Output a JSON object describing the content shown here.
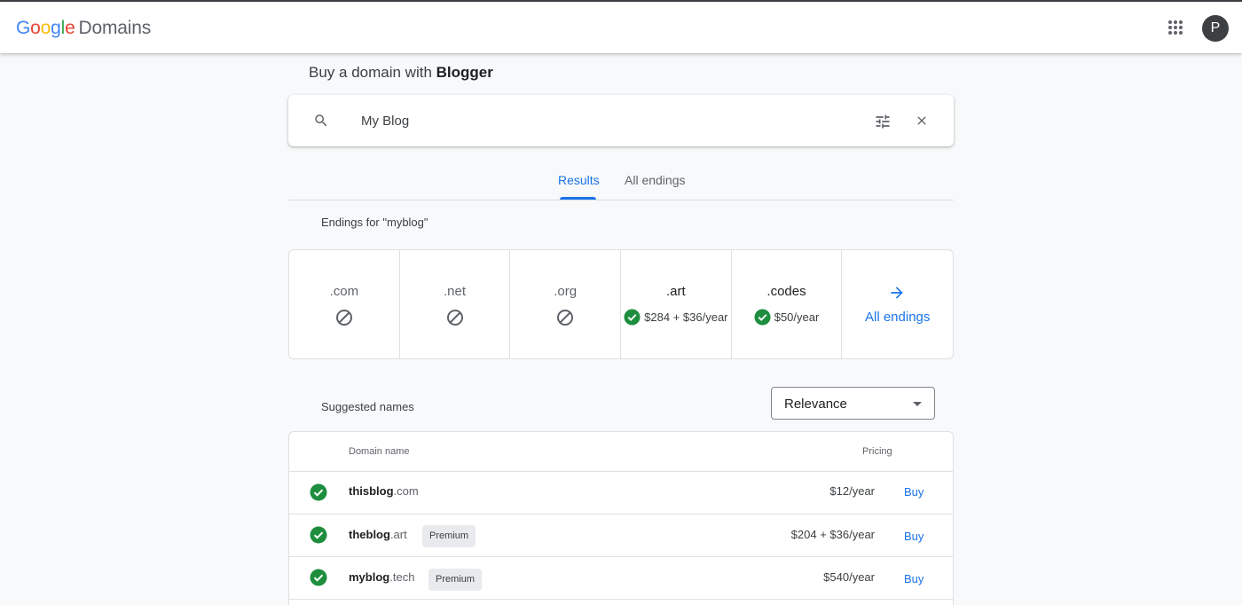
{
  "header": {
    "logo_letters": [
      "G",
      "o",
      "o",
      "g",
      "l",
      "e"
    ],
    "logo_product": "Domains",
    "avatar_letter": "P"
  },
  "page": {
    "title_prefix": "Buy a domain with ",
    "title_bold": "Blogger"
  },
  "search": {
    "value": "My Blog",
    "icon": "search-icon"
  },
  "tabs": [
    {
      "label": "Results",
      "active": true
    },
    {
      "label": "All endings",
      "active": false
    }
  ],
  "endings": {
    "heading": "Endings for \"myblog\"",
    "items": [
      {
        "tld": ".com",
        "available": false,
        "price": ""
      },
      {
        "tld": ".net",
        "available": false,
        "price": ""
      },
      {
        "tld": ".org",
        "available": false,
        "price": ""
      },
      {
        "tld": ".art",
        "available": true,
        "price": "$284 + $36/year"
      },
      {
        "tld": ".codes",
        "available": true,
        "price": "$50/year"
      }
    ],
    "all_endings_label": "All endings"
  },
  "suggested": {
    "heading": "Suggested names",
    "sort_value": "Relevance",
    "columns": {
      "domain": "Domain name",
      "pricing": "Pricing"
    },
    "rows": [
      {
        "name": "thisblog",
        "tld": ".com",
        "badge": "",
        "price": "$12/year",
        "action": "Buy"
      },
      {
        "name": "theblog",
        "tld": ".art",
        "badge": "Premium",
        "price": "$204 + $36/year",
        "action": "Buy"
      },
      {
        "name": "myblog",
        "tld": ".tech",
        "badge": "Premium",
        "price": "$540/year",
        "action": "Buy"
      }
    ]
  },
  "colors": {
    "accent": "#1a73e8",
    "available": "#1e8e3e",
    "unavailable": "#5f6368"
  }
}
